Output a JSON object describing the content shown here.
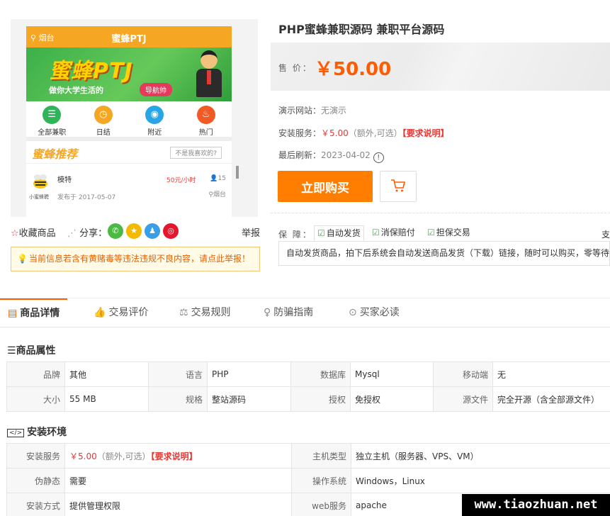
{
  "preview": {
    "location": "烟台",
    "app_title": "蜜蜂PTJ",
    "banner_title": "蜜蜂PTJ",
    "banner_subtitle": "做你大学生活的",
    "banner_button": "导航帅",
    "nav": [
      {
        "label": "全部兼职",
        "icon": "list-icon",
        "color": "#2fb45a"
      },
      {
        "label": "日结",
        "icon": "clock-icon",
        "color": "#f5a623"
      },
      {
        "label": "附近",
        "icon": "location-icon",
        "color": "#27a5e6"
      },
      {
        "label": "热门",
        "icon": "fire-icon",
        "color": "#f15a24"
      }
    ],
    "recommend_title": "蜜蜂推荐",
    "recommend_question": "不是我喜欢的?",
    "item": {
      "name": "模特",
      "logo_caption": "小蜜蜂聘",
      "pay": "50元/小时",
      "count": "15",
      "date": "发布于 2017-05-07",
      "city": "烟台"
    }
  },
  "share": {
    "favorite": "收藏商品",
    "share_label": "分享：",
    "report": "举报",
    "socials": [
      {
        "name": "wechat-icon",
        "color": "#4cb944"
      },
      {
        "name": "qzone-icon",
        "color": "#f5b900"
      },
      {
        "name": "qq-icon",
        "color": "#3a9fe6"
      },
      {
        "name": "weibo-icon",
        "color": "#e6162d"
      }
    ]
  },
  "notice": "当前信息若含有黄赌毒等违法违规不良内容，请点此举报！",
  "product": {
    "title": "PHP蜜蜂兼职源码 兼职平台源码",
    "price_label": "售  价：",
    "price": "￥50.00",
    "demo_label": "演示网站：",
    "demo_value": "无演示",
    "install_label": "安装服务：",
    "install_price": "￥5.00",
    "install_note": "（额外,可选）",
    "install_link": "【要求说明】",
    "refresh_label": "最后刷新：",
    "refresh_value": "2023-04-02",
    "buy_button": "立即购买"
  },
  "guarantee": {
    "label": "保  障：",
    "tabs": [
      "自动发货",
      "消保赔付",
      "担保交易"
    ],
    "more": "支",
    "desc": "自动发货商品，拍下后系统会自动发送商品发货（下载）链接，随时可以购买，零等待"
  },
  "tabs": [
    {
      "label": "商品详情",
      "icon": "detail-icon"
    },
    {
      "label": "交易评价",
      "icon": "thumb-icon"
    },
    {
      "label": "交易规则",
      "icon": "scale-icon"
    },
    {
      "label": "防骗指南",
      "icon": "bulb-icon"
    },
    {
      "label": "买家必读",
      "icon": "compass-icon"
    }
  ],
  "attributes": {
    "title": "商品属性",
    "rows": [
      [
        "品牌",
        "其他",
        "语言",
        "PHP",
        "数据库",
        "Mysql",
        "移动端",
        "无"
      ],
      [
        "大小",
        "55 MB",
        "规格",
        "整站源码",
        "授权",
        "免授权",
        "源文件",
        "完全开源（含全部源文件）"
      ]
    ]
  },
  "environment": {
    "title": "安装环境",
    "rows": [
      {
        "k1": "安装服务",
        "v1_price": "￥5.00",
        "v1_note": "（额外,可选）",
        "v1_link": "【要求说明】",
        "k2": "主机类型",
        "v2": "独立主机（服务器、VPS、VM）"
      },
      {
        "k1": "伪静态",
        "v1": "需要",
        "k2": "操作系统",
        "v2": "Windows，Linux"
      },
      {
        "k1": "安装方式",
        "v1": "提供管理权限",
        "k2": "web服务",
        "v2": "apache"
      }
    ]
  },
  "watermark": "www.tiaozhuan.net"
}
